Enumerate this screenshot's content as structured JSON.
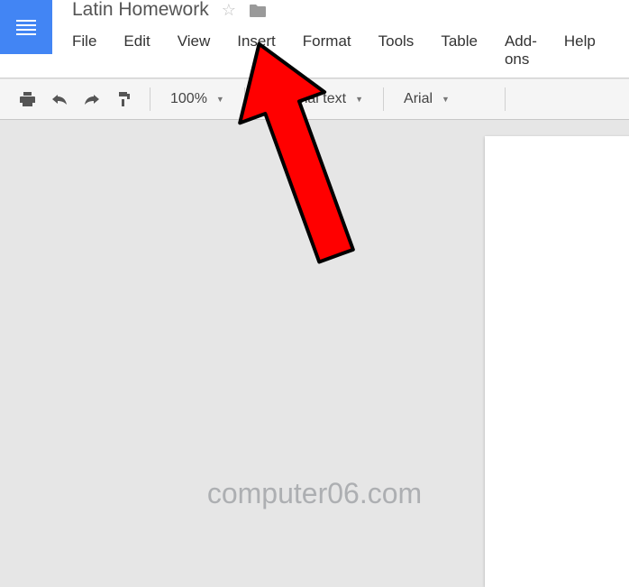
{
  "header": {
    "doc_title": "Latin Homework"
  },
  "menu": {
    "items": [
      "File",
      "Edit",
      "View",
      "Insert",
      "Format",
      "Tools",
      "Table",
      "Add-ons",
      "Help"
    ]
  },
  "toolbar": {
    "zoom": "100%",
    "style": "ormal text",
    "font": "Arial"
  },
  "watermark": "computer06.com",
  "chart_data": null
}
